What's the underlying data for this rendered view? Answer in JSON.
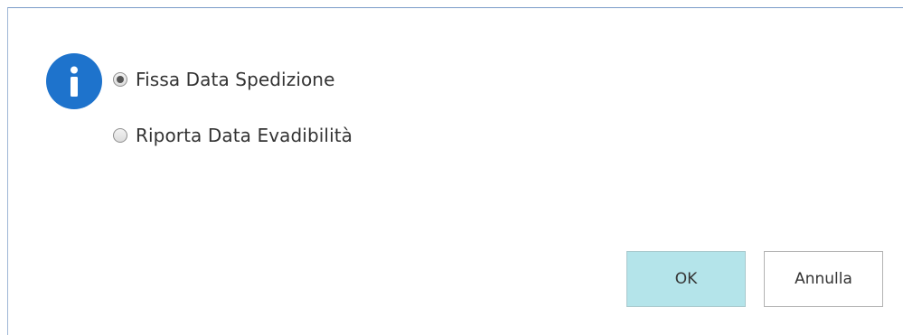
{
  "dialog": {
    "icon": "info-icon",
    "icon_color": "#1e73cc",
    "options": [
      {
        "label": "Fissa Data Spedizione",
        "checked": true
      },
      {
        "label": "Riporta Data Evadibilità",
        "checked": false
      }
    ],
    "buttons": {
      "ok_label": "OK",
      "ok_color": "#b4e4ea",
      "cancel_label": "Annulla"
    }
  }
}
